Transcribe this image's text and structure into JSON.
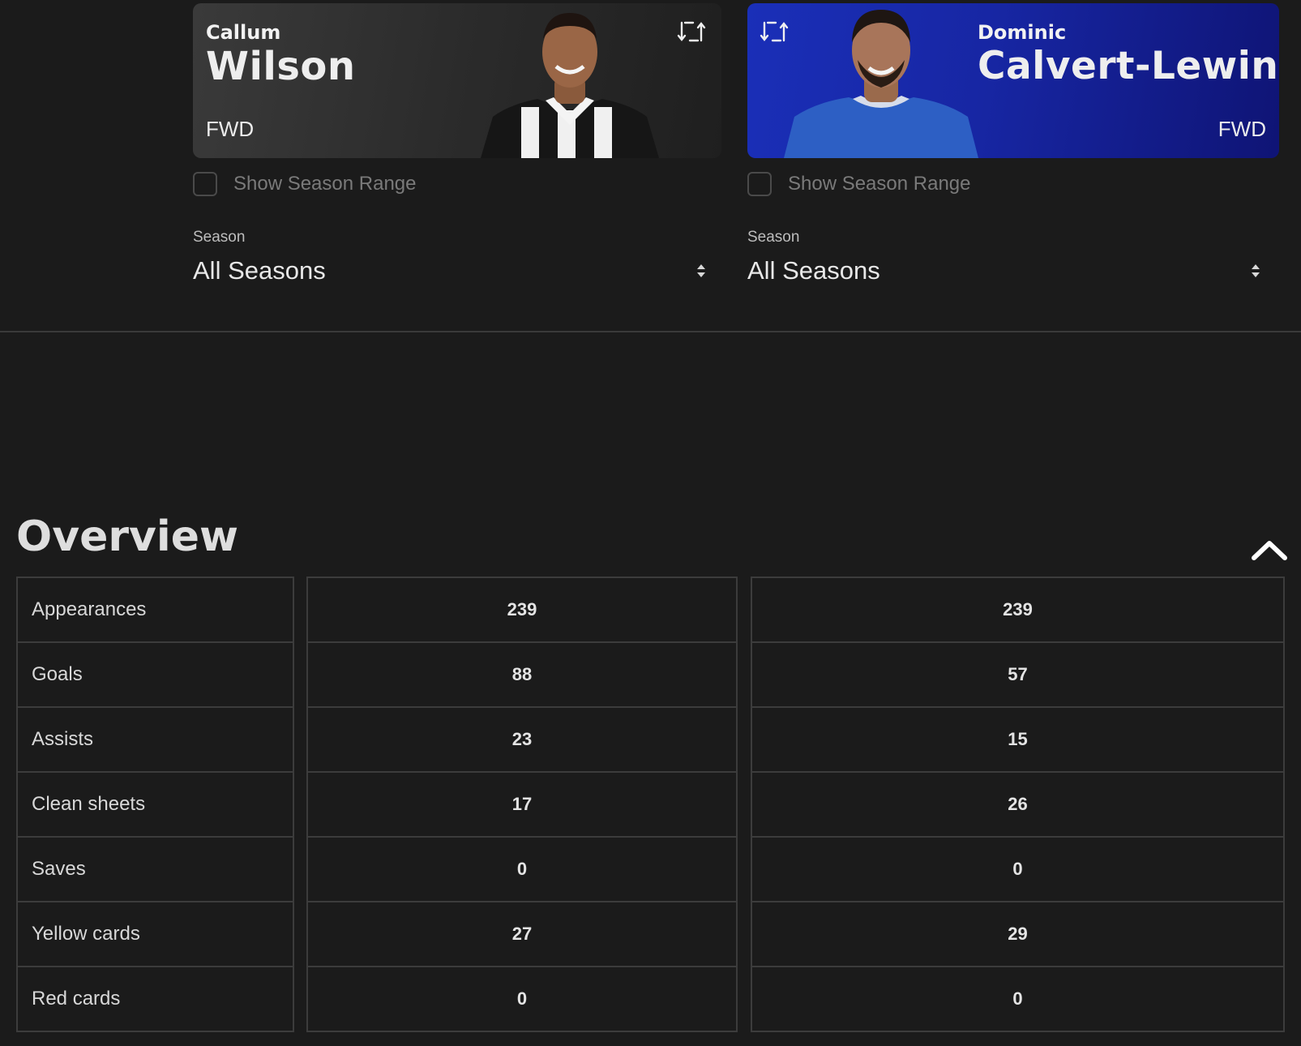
{
  "player1": {
    "first_name": "Callum",
    "last_name": "Wilson",
    "position": "FWD",
    "range_label": "Show Season Range",
    "season_label": "Season",
    "season_value": "All Seasons"
  },
  "player2": {
    "first_name": "Dominic",
    "last_name": "Calvert-Lewin",
    "position": "FWD",
    "range_label": "Show Season Range",
    "season_label": "Season",
    "season_value": "All Seasons"
  },
  "overview": {
    "title": "Overview",
    "rows": [
      {
        "label": "Appearances",
        "p1": "239",
        "p2": "239"
      },
      {
        "label": "Goals",
        "p1": "88",
        "p2": "57"
      },
      {
        "label": "Assists",
        "p1": "23",
        "p2": "15"
      },
      {
        "label": "Clean sheets",
        "p1": "17",
        "p2": "26"
      },
      {
        "label": "Saves",
        "p1": "0",
        "p2": "0"
      },
      {
        "label": "Yellow cards",
        "p1": "27",
        "p2": "29"
      },
      {
        "label": "Red cards",
        "p1": "0",
        "p2": "0"
      }
    ]
  },
  "colors": {
    "background": "#1b1b1b",
    "card_left": "#2b2b2b",
    "card_right": "#1726a3",
    "border": "#3c3c3c"
  },
  "icons": {
    "swap": "swap-icon",
    "collapse": "chevron-up-icon",
    "select": "select-arrows-icon"
  }
}
